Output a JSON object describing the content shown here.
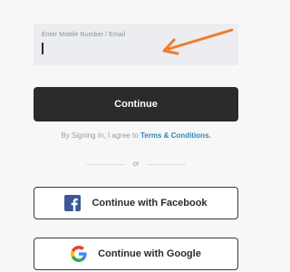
{
  "login": {
    "input_label": "Enter Mobile Number / Email",
    "input_value": "",
    "continue_label": "Continue",
    "terms_prefix": "By Signing In, I agree to ",
    "terms_link": "Terms & Conditions.",
    "divider_text": "or",
    "facebook_label": "Continue with Facebook",
    "google_label": "Continue with Google"
  },
  "annotation": {
    "arrow_color": "#f07c2c"
  },
  "colors": {
    "primary_button": "#2b2b2b",
    "link": "#2a8ab8",
    "facebook": "#3b5998",
    "input_background": "#ebedf1"
  },
  "icons": {
    "facebook": "facebook-icon",
    "google": "google-icon",
    "arrow": "arrow-icon"
  }
}
